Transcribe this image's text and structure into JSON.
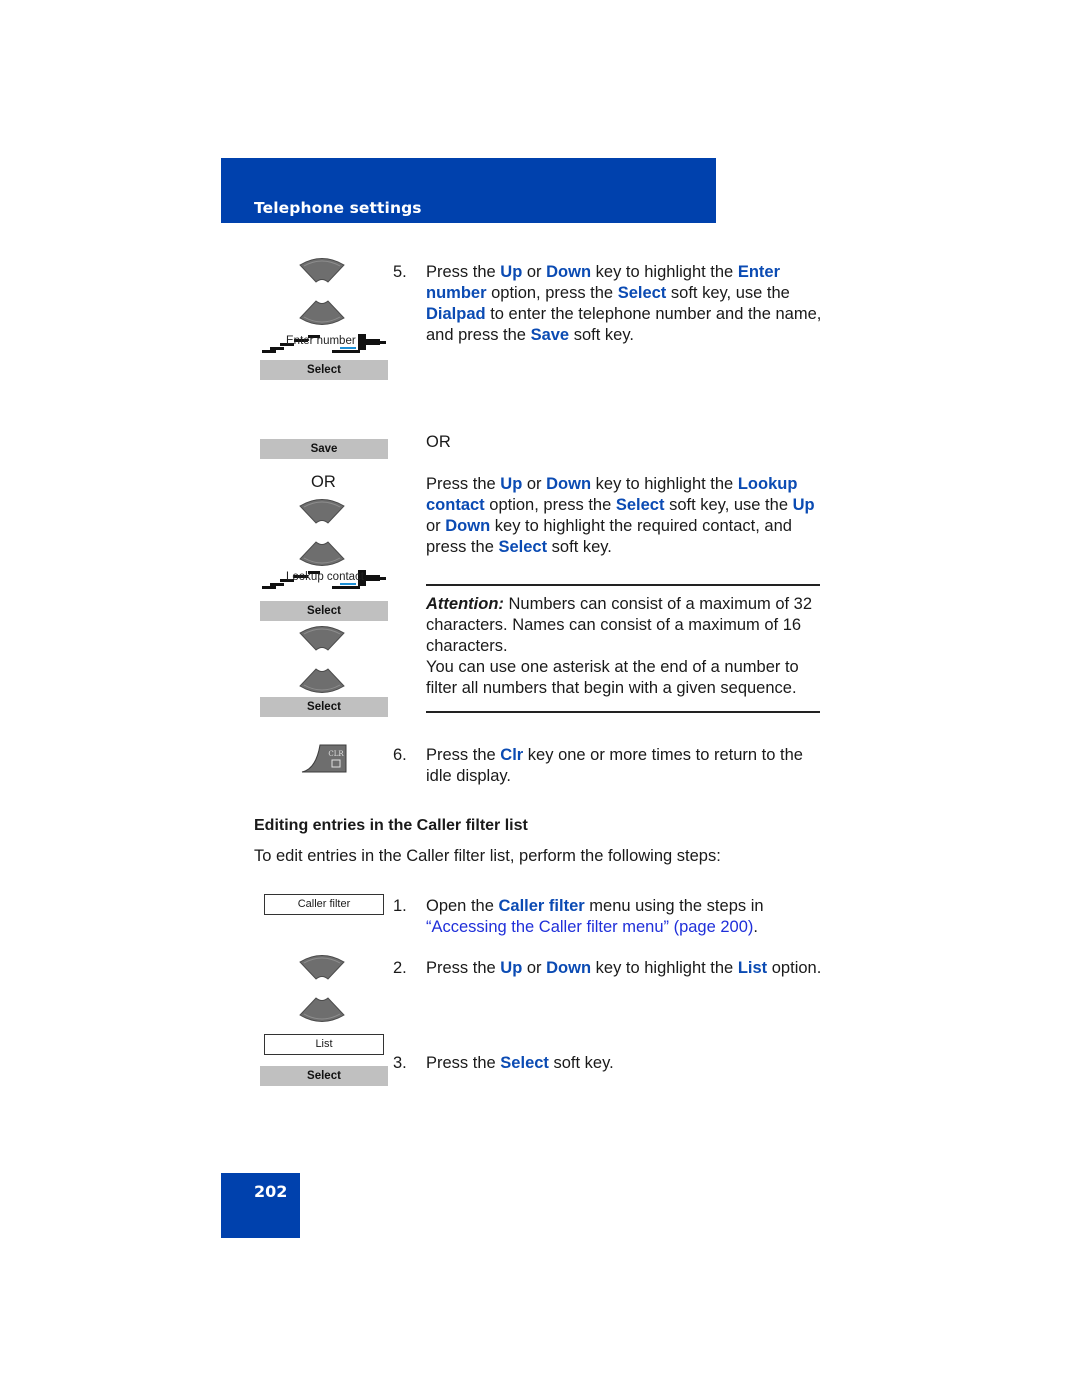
{
  "header": {
    "title": "Telephone settings"
  },
  "page_number": "202",
  "step5": {
    "number": "5.",
    "parts": [
      {
        "t": "Press the "
      },
      {
        "t": "Up",
        "b": true
      },
      {
        "t": " or "
      },
      {
        "t": "Down",
        "b": true
      },
      {
        "t": " key to highlight the "
      },
      {
        "t": "Enter number",
        "b": true
      },
      {
        "t": " option, press the "
      },
      {
        "t": "Select",
        "b": true
      },
      {
        "t": " soft key, use the "
      },
      {
        "t": "Dialpad",
        "b": true
      },
      {
        "t": " to enter the telephone number and the name, and press the "
      },
      {
        "t": "Save",
        "b": true
      },
      {
        "t": " soft key."
      }
    ]
  },
  "or_label": "OR",
  "step5_alt": {
    "parts": [
      {
        "t": "Press the "
      },
      {
        "t": "Up",
        "b": true
      },
      {
        "t": " or "
      },
      {
        "t": "Down",
        "b": true
      },
      {
        "t": " key to highlight the "
      },
      {
        "t": "Lookup contact",
        "b": true
      },
      {
        "t": " option, press the "
      },
      {
        "t": "Select",
        "b": true
      },
      {
        "t": " soft key, use the "
      },
      {
        "t": "Up",
        "b": true
      },
      {
        "t": " or "
      },
      {
        "t": "Down",
        "b": true
      },
      {
        "t": " key to highlight the required contact, and press the "
      },
      {
        "t": "Select",
        "b": true
      },
      {
        "t": " soft key."
      }
    ]
  },
  "attention": {
    "label": "Attention:",
    "text1": " Numbers can consist of a maximum of 32 characters. Names can consist of a maximum of 16 characters.",
    "text2": "You can use one asterisk at the end of a number to filter all numbers that begin with a given sequence."
  },
  "step6": {
    "number": "6.",
    "parts": [
      {
        "t": "Press the "
      },
      {
        "t": "Clr",
        "b": true
      },
      {
        "t": " key one or more times to return to the idle display."
      }
    ]
  },
  "section": {
    "heading": "Editing entries in the Caller filter list",
    "intro": "To edit entries in the Caller filter list, perform the following steps:"
  },
  "steps": [
    {
      "number": "1.",
      "parts": [
        {
          "t": "Open the "
        },
        {
          "t": "Caller filter",
          "b": true
        },
        {
          "t": " menu using the steps in "
        },
        {
          "t": "“Accessing the Caller filter menu” (page 200)",
          "link": true
        },
        {
          "t": "."
        }
      ]
    },
    {
      "number": "2.",
      "parts": [
        {
          "t": "Press the "
        },
        {
          "t": "Up",
          "b": true
        },
        {
          "t": " or "
        },
        {
          "t": "Down",
          "b": true
        },
        {
          "t": " key to highlight the "
        },
        {
          "t": "List",
          "b": true
        },
        {
          "t": " option."
        }
      ]
    },
    {
      "number": "3.",
      "parts": [
        {
          "t": "Press the "
        },
        {
          "t": "Select",
          "b": true
        },
        {
          "t": " soft key."
        }
      ]
    }
  ],
  "illustrations": {
    "enter_number_label": "Enter number",
    "lookup_contact_label": "Lookup contact",
    "select_key": "Select",
    "save_key": "Save",
    "or_label": "OR",
    "clr_key": "CLR",
    "caller_filter_menu": "Caller filter",
    "list_menu": "List"
  },
  "colors": {
    "brand_blue": "#0041ad",
    "keyword_blue": "#0b4bb3",
    "link_blue": "#1f2fd9",
    "softkey_gray": "#c0c0c0"
  }
}
